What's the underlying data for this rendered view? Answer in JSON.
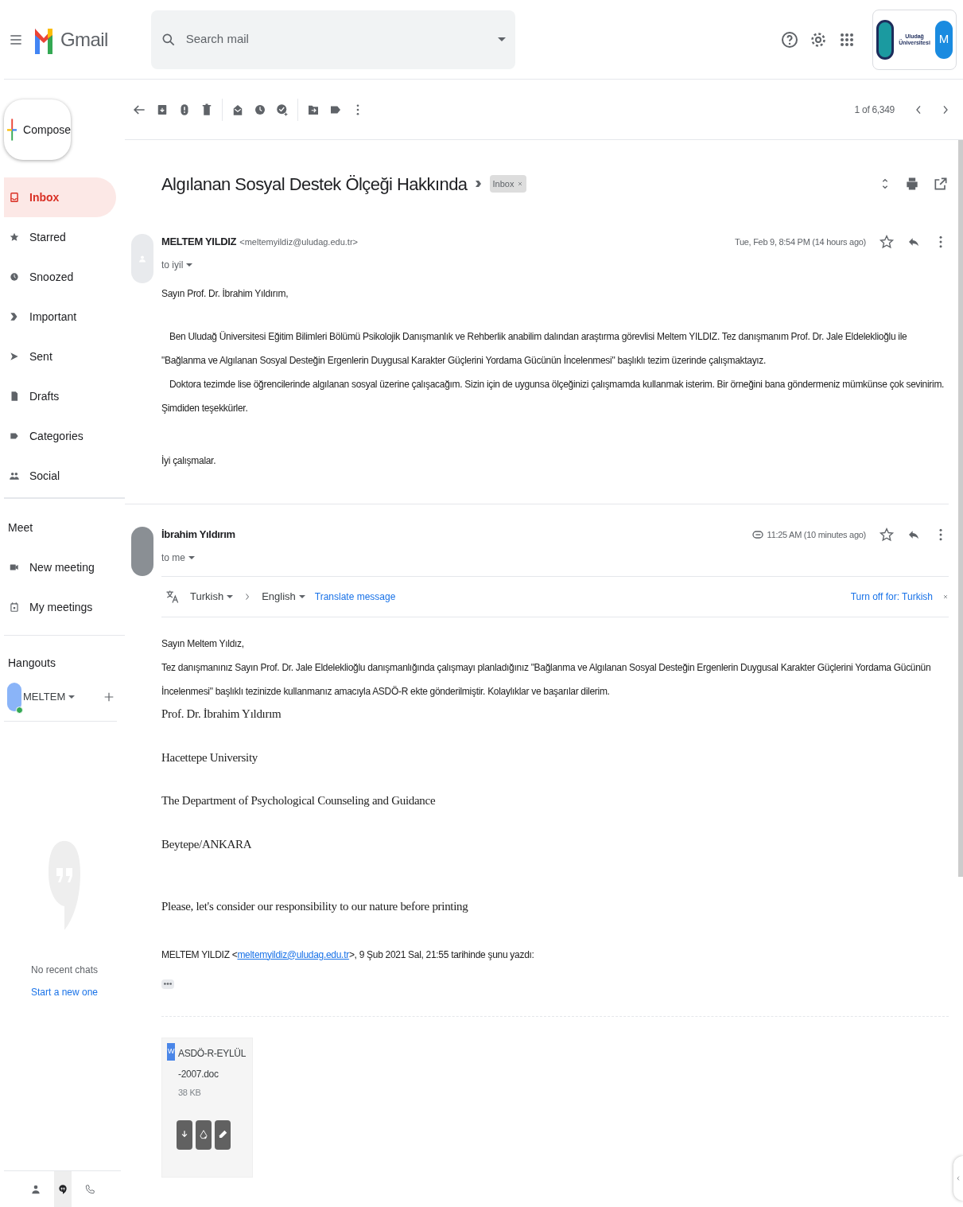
{
  "header": {
    "app_name": "Gmail",
    "search_placeholder": "Search mail",
    "org_logo_text": "Uludağ Üniversitesi",
    "avatar_letter": "M"
  },
  "sidebar": {
    "compose": "Compose",
    "items": [
      {
        "label": "Inbox",
        "selected": true
      },
      {
        "label": "Starred",
        "selected": false
      },
      {
        "label": "Snoozed",
        "selected": false
      },
      {
        "label": "Important",
        "selected": false
      },
      {
        "label": "Sent",
        "selected": false
      },
      {
        "label": "Drafts",
        "selected": false
      },
      {
        "label": "Categories",
        "selected": false
      },
      {
        "label": "Social",
        "selected": false
      }
    ],
    "meet": {
      "title": "Meet",
      "items": [
        {
          "label": "New meeting"
        },
        {
          "label": "My meetings"
        }
      ]
    },
    "hangouts": {
      "title": "Hangouts",
      "user": "MELTEM",
      "online": true,
      "empty_text": "No recent chats",
      "start_link": "Start a new one"
    },
    "bottom_tabs": [
      {
        "selected": false
      },
      {
        "selected": true
      },
      {
        "selected": false
      }
    ]
  },
  "toolbar": {
    "pager": "1 of 6,349"
  },
  "thread": {
    "subject": "Algılanan Sosyal Destek Ölçeği Hakkında",
    "label": "Inbox",
    "messages": [
      {
        "sender": "MELTEM YILDIZ",
        "email": "<meltemyildiz@uludag.edu.tr>",
        "recipient": "to iyil",
        "date": "Tue, Feb 9, 8:54 PM (14 hours ago)",
        "has_attachment": false,
        "body": [
          {
            "kind": "text",
            "text": "Sayın Prof. Dr. İbrahim Yıldırım,"
          },
          {
            "kind": "indent",
            "text": "Ben Uludağ Üniversitesi Eğitim Bilimleri Bölümü Psikolojik Danışmanlık ve Rehberlik anabilim dalından araştırma görevlisi Meltem YILDIZ. Tez danışmanım Prof. Dr. Jale Eldeleklioğlu ile \"Bağlanma ve Algılanan Sosyal Desteğin Ergenlerin Duygusal Karakter Güçlerini Yordama Gücünün İncelenmesi\" başlıklı tezim üzerinde çalışmaktayız."
          },
          {
            "kind": "indent",
            "text": "Doktora tezimde lise öğrencilerinde algılanan sosyal üzerine çalışacağım. Sizin için de uygunsa ölçeğinizi çalışmamda kullanmak isterim. Bir örneğini bana göndermeniz mümkünse çok sevinirim. Şimdiden teşekkürler."
          },
          {
            "kind": "text",
            "text": "İyi çalışmalar."
          }
        ]
      },
      {
        "sender": "İbrahim Yıldırım",
        "recipient": "to me",
        "date": "11:25 AM (10 minutes ago)",
        "has_attachment": true,
        "translate": {
          "from": "Turkish",
          "to": "English",
          "action": "Translate message",
          "turn_off": "Turn off for: Turkish"
        },
        "body": [
          {
            "kind": "tight",
            "text": "Sayın Meltem Yıldız,"
          },
          {
            "kind": "tight",
            "text": "Tez danışmanınız Sayın Prof. Dr. Jale Eldeleklioğlu danışmanlığında çalışmayı planladığınız \"Bağlanma ve Algılanan Sosyal Desteğin Ergenlerin Duygusal Karakter Güçlerini Yordama Gücünün İncelenmesi\" başlıklı tezinizde kullanmanız amacıyla ASDÖ-R ekte gönderilmiştir. Kolaylıklar ve başarılar dilerim."
          },
          {
            "kind": "serif",
            "text": "Prof. Dr. İbrahim Yıldırım"
          },
          {
            "kind": "serif",
            "text": "Hacettepe University"
          },
          {
            "kind": "serif",
            "text": "The Department of Psychological Counseling and Guidance"
          },
          {
            "kind": "serif",
            "text": "Beytepe/ANKARA"
          },
          {
            "kind": "serif",
            "text": "Please, let's consider our responsibility to our nature before printing"
          },
          {
            "kind": "quote_header",
            "before": "MELTEM YILDIZ <",
            "link": "meltemyildiz@uludag.edu.tr",
            "after": ">, 9 Şub 2021 Sal, 21:55 tarihinde şunu yazdı:"
          }
        ],
        "attachments": [
          {
            "name": "ASDÖ-R-EYLÜL-2007.doc",
            "size": "38 KB",
            "type": "W"
          }
        ]
      }
    ]
  }
}
